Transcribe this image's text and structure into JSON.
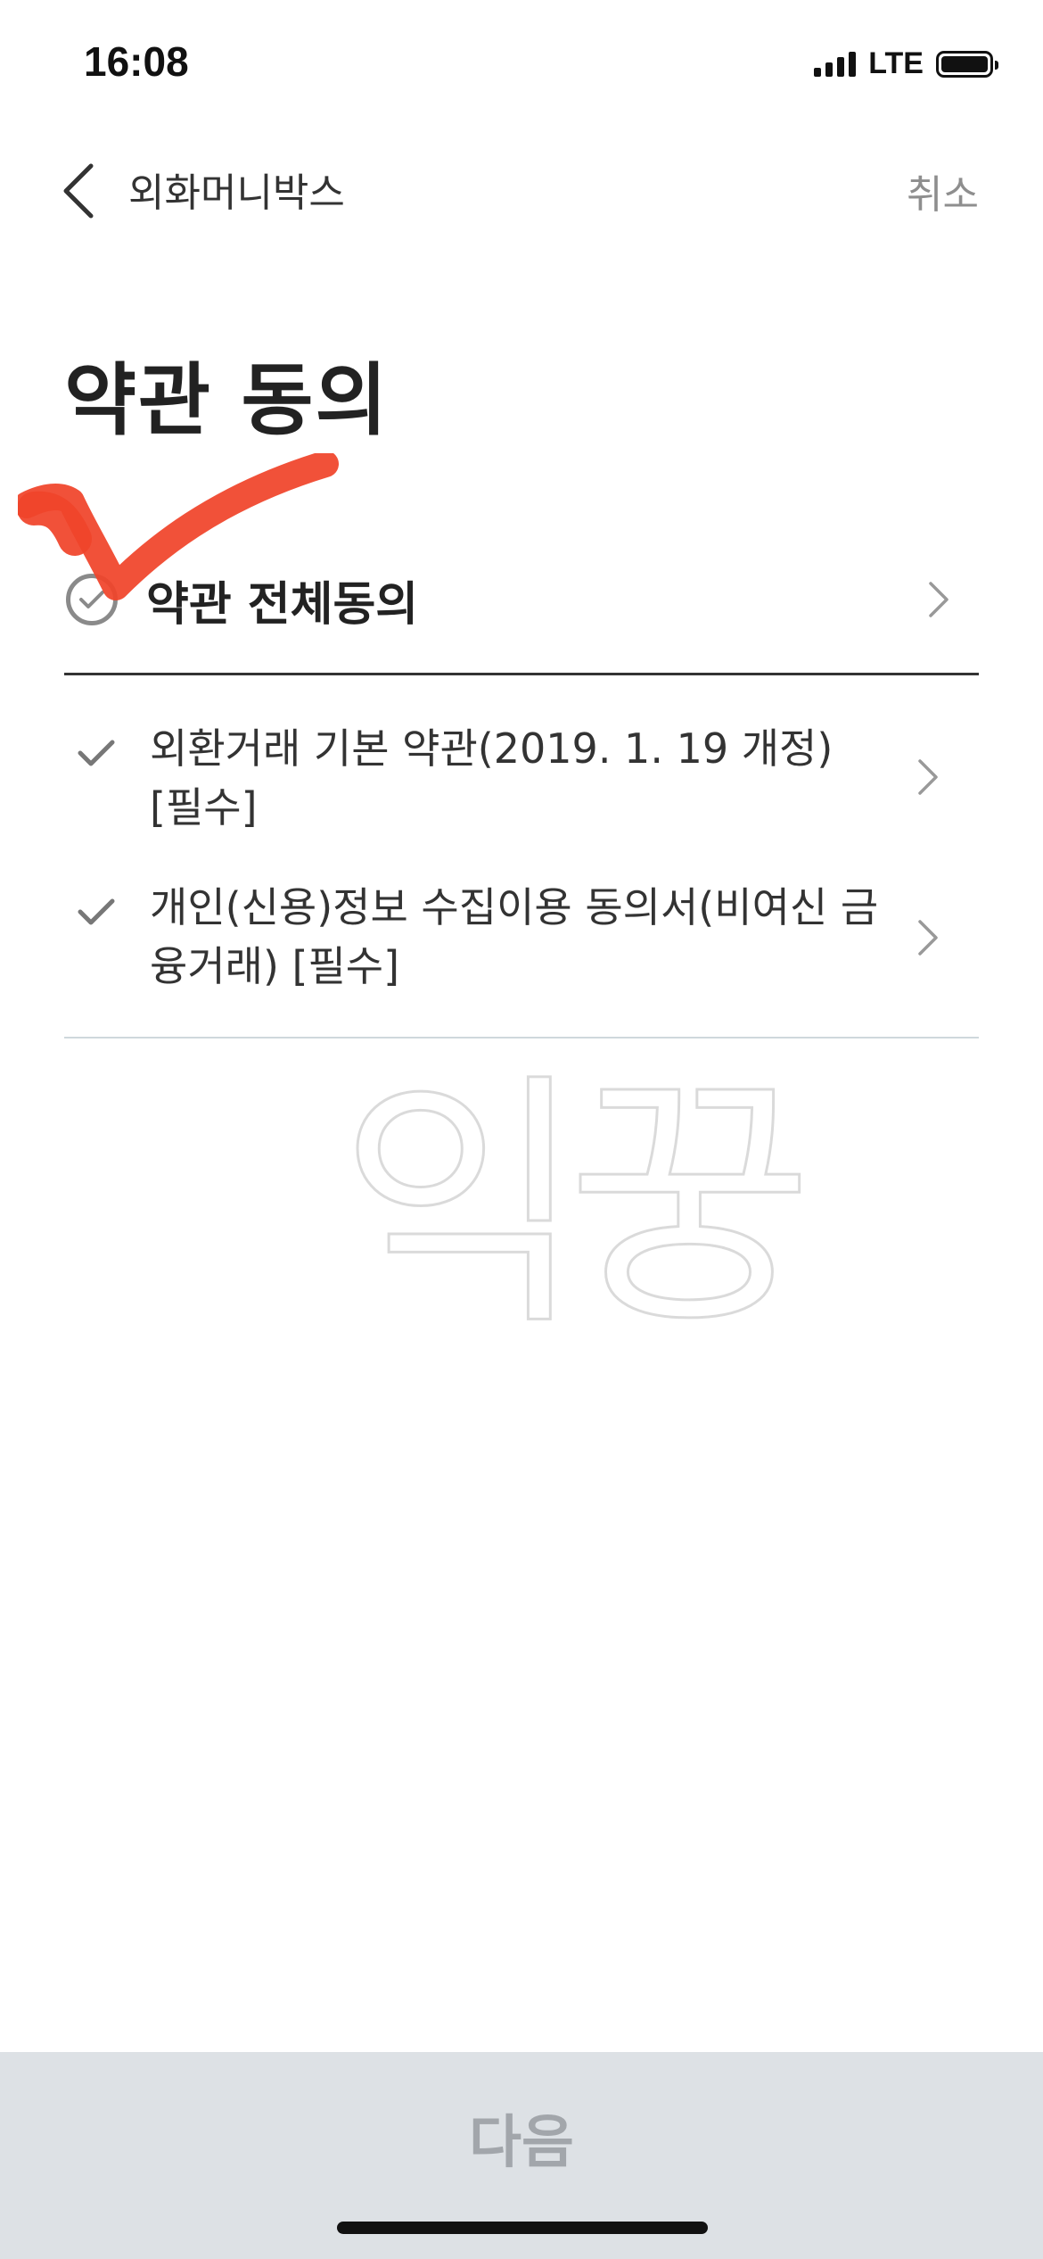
{
  "status_bar": {
    "time": "16:08",
    "network": "LTE"
  },
  "nav": {
    "back_label": "외화머니박스",
    "cancel_label": "취소"
  },
  "page": {
    "title": "약관 동의"
  },
  "agree_all": {
    "label": "약관 전체동의"
  },
  "terms": [
    {
      "label": "외환거래 기본 약관(2019. 1. 19 개정) [필수]"
    },
    {
      "label": "개인(신용)정보 수집이용 동의서(비여신 금융거래) [필수]"
    }
  ],
  "watermark": "익꿍",
  "footer": {
    "next_label": "다음"
  },
  "colors": {
    "annotation_red": "#f0442a",
    "button_bg": "#dde1e5",
    "button_text": "#a2a6ab"
  }
}
